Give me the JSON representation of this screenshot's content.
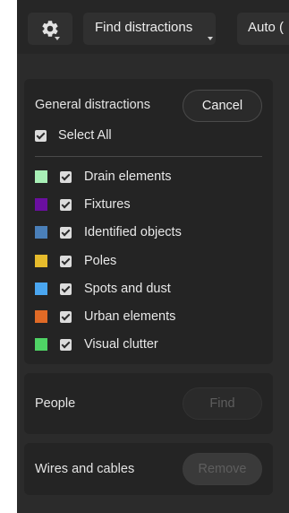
{
  "toolbar": {
    "gear_icon": "gear-icon",
    "find_label": "Find distractions",
    "auto_label": "Auto ("
  },
  "general": {
    "title": "General distractions",
    "cancel_label": "Cancel",
    "select_all_label": "Select All",
    "items": [
      {
        "label": "Drain elements",
        "color": "#a8efb6"
      },
      {
        "label": "Fixtures",
        "color": "#6a0fa0"
      },
      {
        "label": "Identified objects",
        "color": "#4a7fb8"
      },
      {
        "label": "Poles",
        "color": "#e6bb2c"
      },
      {
        "label": "Spots and dust",
        "color": "#4aa6f0"
      },
      {
        "label": "Urban elements",
        "color": "#e06a26"
      },
      {
        "label": "Visual clutter",
        "color": "#4fd365"
      }
    ]
  },
  "people": {
    "title": "People",
    "find_label": "Find"
  },
  "wires": {
    "title": "Wires and cables",
    "remove_label": "Remove"
  }
}
